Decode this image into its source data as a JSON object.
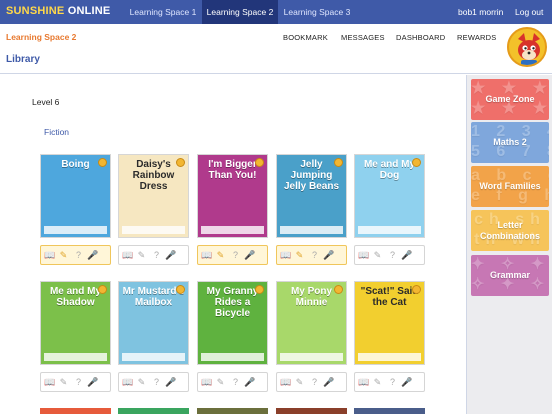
{
  "topbar": {
    "brand_part1": "SUNSHINE",
    "brand_part2": " ONLINE",
    "tabs": [
      {
        "label": "Learning Space 1"
      },
      {
        "label": "Learning Space 2"
      },
      {
        "label": "Learning Space 3"
      }
    ],
    "active_tab": "Learning Space 2",
    "user": "bob1 morrin",
    "logout": "Log out"
  },
  "header": {
    "space_title": "Learning Space 2",
    "page_title": "Library",
    "nav": [
      "BOOKMARK",
      "MESSAGES",
      "DASHBOARD",
      "REWARDS"
    ]
  },
  "library": {
    "level": "Level 6",
    "section": "Fiction",
    "books": [
      {
        "title": "Boing",
        "read": true,
        "cover_color": "#4ea7dd"
      },
      {
        "title": "Daisy's Rainbow Dress",
        "read": false,
        "cover_color": "#f6e7c1"
      },
      {
        "title": "I'm Bigger Than You!",
        "read": true,
        "cover_color": "#b03a8c"
      },
      {
        "title": "Jelly Jumping Jelly Beans",
        "read": true,
        "cover_color": "#4aa0c9"
      },
      {
        "title": "Me and My Dog",
        "read": false,
        "cover_color": "#8fd1ee"
      },
      {
        "title": "Me and My Shadow",
        "read": false,
        "cover_color": "#7cc04a"
      },
      {
        "title": "Mr Mustard's Mailbox",
        "read": false,
        "cover_color": "#7fc3e0"
      },
      {
        "title": "My Granny Rides a Bicycle",
        "read": false,
        "cover_color": "#5fb23f"
      },
      {
        "title": "My Pony Minnie",
        "read": false,
        "cover_color": "#a8d86a"
      },
      {
        "title": "\"Scat!\" Said the Cat",
        "read": false,
        "cover_color": "#f2cf2f"
      }
    ]
  },
  "sidebar": [
    {
      "label": "Game Zone",
      "color": "#ef6f6a"
    },
    {
      "label": "Maths 2",
      "color": "#7fa7dc"
    },
    {
      "label": "Word Families",
      "color": "#f2a349"
    },
    {
      "label": "Letter Combinations",
      "color": "#f6c45a"
    },
    {
      "label": "Grammar",
      "color": "#c777b4"
    }
  ]
}
